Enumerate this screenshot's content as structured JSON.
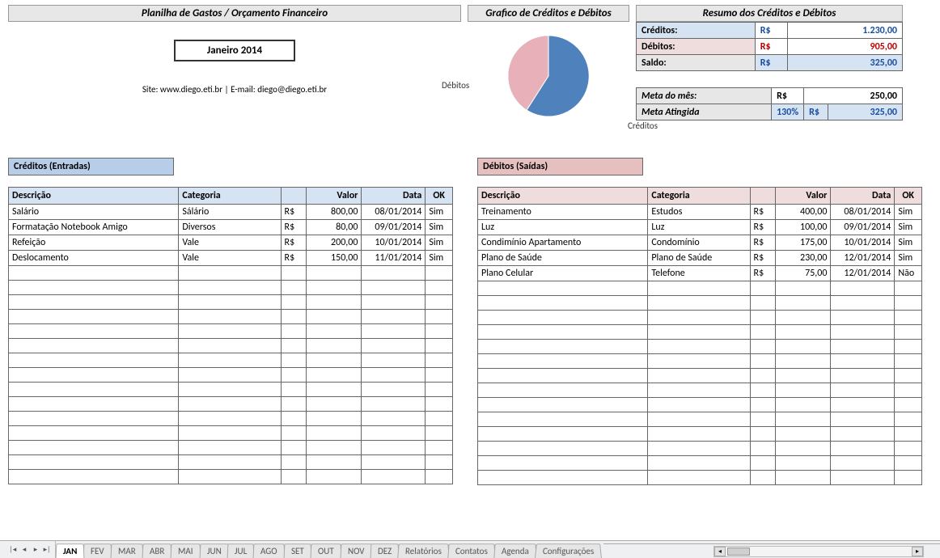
{
  "header": {
    "title": "Planilha de Gastos / Orçamento Financeiro",
    "month": "Janeiro 2014",
    "site_line": "Site: www.diego.eti.br  |  E-mail: diego@diego.eti.br"
  },
  "chart": {
    "title": "Grafico de Créditos e Débitos",
    "label_debits": "Débitos",
    "label_credits": "Créditos"
  },
  "summary": {
    "title": "Resumo dos Créditos e Débitos",
    "credits_label": "Créditos:",
    "credits_currency": "R$",
    "credits_value": "1.230,00",
    "debits_label": "Débitos:",
    "debits_currency": "R$",
    "debits_value": "905,00",
    "balance_label": "Saldo:",
    "balance_currency": "R$",
    "balance_value": "325,00",
    "goal_label": "Meta  do mês:",
    "goal_currency": "R$",
    "goal_value": "250,00",
    "goal_reached_label": "Meta Atingida",
    "goal_pct": "130%",
    "goal_reached_currency": "R$",
    "goal_reached_value": "325,00"
  },
  "credits": {
    "header": "Créditos (Entradas)",
    "col_desc": "Descrição",
    "col_cat": "Categoria",
    "col_val": "Valor",
    "col_date": "Data",
    "col_ok": "OK",
    "rows": [
      {
        "desc": "Salário",
        "cat": "Sálário",
        "cur": "R$",
        "val": "800,00",
        "date": "08/01/2014",
        "ok": "Sim"
      },
      {
        "desc": "Formatação Notebook Amigo",
        "cat": "Diversos",
        "cur": "R$",
        "val": "80,00",
        "date": "09/01/2014",
        "ok": "Sim"
      },
      {
        "desc": "Refeição",
        "cat": "Vale",
        "cur": "R$",
        "val": "200,00",
        "date": "10/01/2014",
        "ok": "Sim"
      },
      {
        "desc": "Deslocamento",
        "cat": "Vale",
        "cur": "R$",
        "val": "150,00",
        "date": "11/01/2014",
        "ok": "Sim"
      }
    ]
  },
  "debits": {
    "header": "Débitos (Saídas)",
    "col_desc": "Descrição",
    "col_cat": "Categoria",
    "col_val": "Valor",
    "col_date": "Data",
    "col_ok": "OK",
    "rows": [
      {
        "desc": "Treinamento",
        "cat": "Estudos",
        "cur": "R$",
        "val": "400,00",
        "date": "08/01/2014",
        "ok": "Sim"
      },
      {
        "desc": "Luz",
        "cat": "Luz",
        "cur": "R$",
        "val": "100,00",
        "date": "09/01/2014",
        "ok": "Sim"
      },
      {
        "desc": "Condimínio Apartamento",
        "cat": "Condomínio",
        "cur": "R$",
        "val": "175,00",
        "date": "10/01/2014",
        "ok": "Sim"
      },
      {
        "desc": "Plano de Saúde",
        "cat": "Plano de Saúde",
        "cur": "R$",
        "val": "230,00",
        "date": "12/01/2014",
        "ok": "Sim"
      },
      {
        "desc": "Plano Celular",
        "cat": "Telefone",
        "cur": "R$",
        "val": "75,00",
        "date": "12/01/2014",
        "ok": "Não"
      }
    ]
  },
  "tabs": [
    "JAN",
    "FEV",
    "MAR",
    "ABR",
    "MAI",
    "JUN",
    "JUL",
    "AGO",
    "SET",
    "OUT",
    "NOV",
    "DEZ",
    "Relatórios",
    "Contatos",
    "Agenda",
    "Configurações"
  ],
  "active_tab": "JAN",
  "empty_rows_credit": 15,
  "empty_rows_debit": 14,
  "chart_data": {
    "type": "pie",
    "title": "Grafico de Créditos e Débitos",
    "series": [
      {
        "name": "Créditos",
        "value": 1230.0,
        "color": "#4f81bd"
      },
      {
        "name": "Débitos",
        "value": 905.0,
        "color": "#e8b0b8"
      }
    ]
  }
}
